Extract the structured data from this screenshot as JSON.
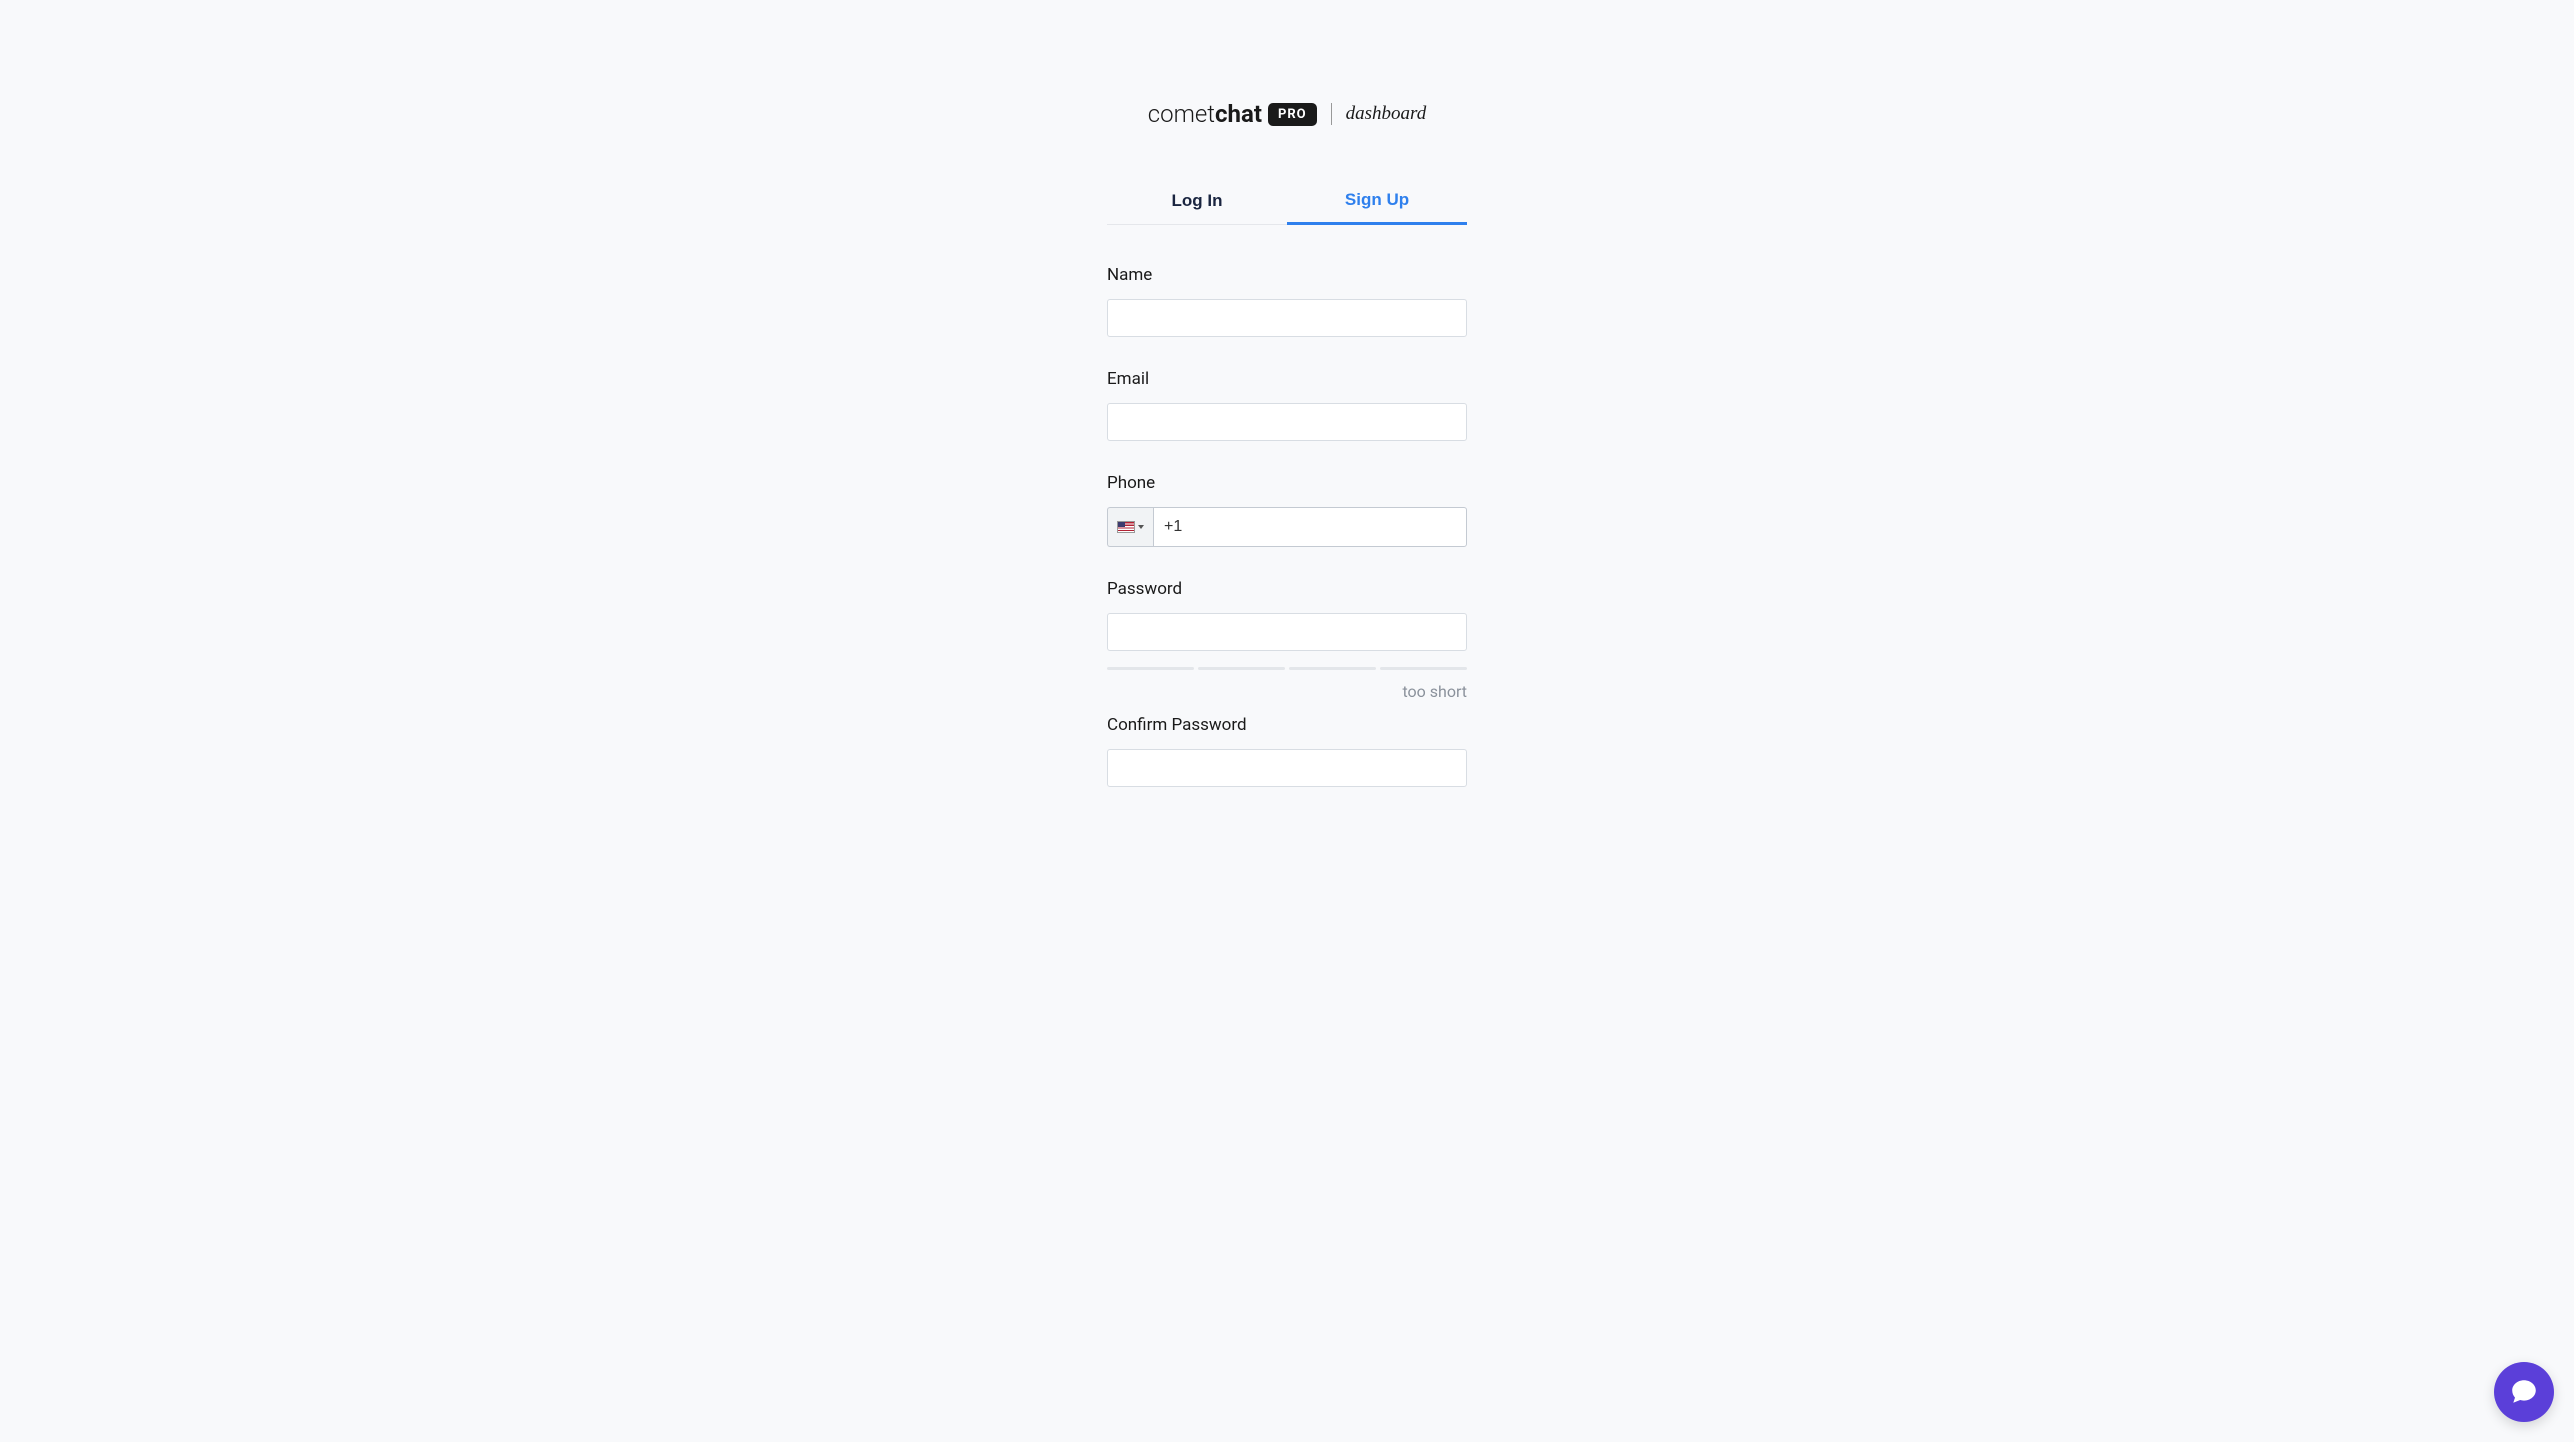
{
  "logo": {
    "brand_prefix": "comet",
    "brand_suffix": "chat",
    "badge": "PRO",
    "suffix": "dashboard"
  },
  "tabs": {
    "login": "Log In",
    "signup": "Sign Up",
    "active": "signup"
  },
  "form": {
    "name": {
      "label": "Name",
      "value": ""
    },
    "email": {
      "label": "Email",
      "value": ""
    },
    "phone": {
      "label": "Phone",
      "value": "+1",
      "country_flag": "us"
    },
    "password": {
      "label": "Password",
      "value": "",
      "strength_text": "too short"
    },
    "confirm_password": {
      "label": "Confirm Password",
      "value": ""
    }
  }
}
